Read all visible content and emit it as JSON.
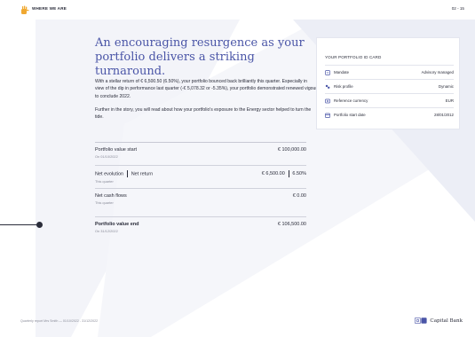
{
  "header": {
    "section": "WHERE WE ARE",
    "page_number": "02 - 15"
  },
  "main": {
    "headline": "An encouraging resurgence as your portfolio delivers a striking turnaround.",
    "paragraph1": "With a stellar return of € 6,500.50 (6.50%), your portfolio bounced back brilliantly this quarter. Especially in view of the dip in performance last quarter (-€ 5,078.32 or -5.35%), your portfolio demonstrated renewed vigour to conclude 2022.",
    "paragraph2": "Further in the story, you will read about how your portfolio's exposure to the Energy sector helped to turn the tide."
  },
  "table": {
    "start_label": "Portfolio value start",
    "start_sub": "On 01/10/2022",
    "start_value": "€ 100,000.00",
    "evo_label": "Net evolution",
    "return_label": "Net return",
    "evo_sub": "This quarter",
    "evo_value": "€ 6,500.00",
    "return_value": "6.50%",
    "cash_label": "Net cash flows",
    "cash_sub": "This quarter",
    "cash_value": "€ 0.00",
    "end_label": "Portfolio value end",
    "end_sub": "On 31/12/2022",
    "end_value": "€ 106,500.00"
  },
  "idcard": {
    "title": "YOUR PORTFOLIO ID CARD",
    "rows": [
      {
        "icon": "mandate-icon",
        "label": "Mandate",
        "value": "Advisory managed"
      },
      {
        "icon": "risk-profile-icon",
        "label": "Risk profile",
        "value": "Dynamic"
      },
      {
        "icon": "currency-icon",
        "label": "Reference currency",
        "value": "EUR"
      },
      {
        "icon": "calendar-icon",
        "label": "Portfolio start date",
        "value": "28/01/2012"
      }
    ]
  },
  "footer": {
    "report": "Quarterly report Mrs Smith — 01/10/2022 - 31/12/2022",
    "brand": "Capital Bank"
  },
  "colors": {
    "accent": "#4a55a7",
    "text": "#2a2c3a",
    "background_shape": "#eef0f7"
  }
}
